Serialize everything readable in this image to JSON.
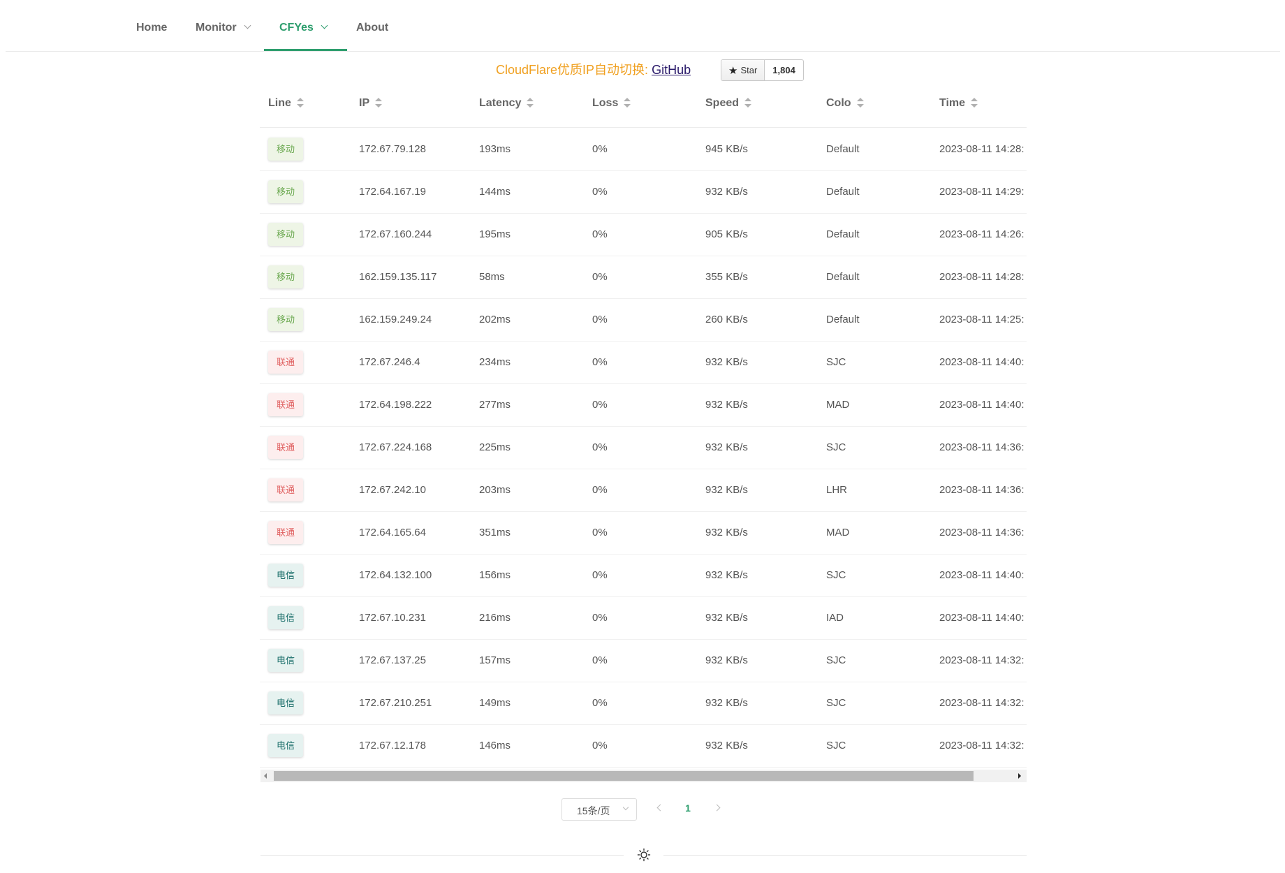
{
  "nav": {
    "items": [
      {
        "label": "Home",
        "dropdown": false
      },
      {
        "label": "Monitor",
        "dropdown": true
      },
      {
        "label": "CFYes",
        "dropdown": true,
        "active": true
      },
      {
        "label": "About",
        "dropdown": false
      }
    ]
  },
  "banner": {
    "text": "CloudFlare优质IP自动切换: ",
    "link": "GitHub"
  },
  "github_star": {
    "label": "Star",
    "count": "1,804"
  },
  "table": {
    "columns": [
      "Line",
      "IP",
      "Latency",
      "Loss",
      "Speed",
      "Colo",
      "Time"
    ],
    "rows": [
      {
        "line": "移动",
        "line_type": "mobile",
        "ip": "172.67.79.128",
        "latency": "193ms",
        "loss": "0%",
        "speed": "945 KB/s",
        "colo": "Default",
        "time": "2023-08-11 14:28:"
      },
      {
        "line": "移动",
        "line_type": "mobile",
        "ip": "172.64.167.19",
        "latency": "144ms",
        "loss": "0%",
        "speed": "932 KB/s",
        "colo": "Default",
        "time": "2023-08-11 14:29:"
      },
      {
        "line": "移动",
        "line_type": "mobile",
        "ip": "172.67.160.244",
        "latency": "195ms",
        "loss": "0%",
        "speed": "905 KB/s",
        "colo": "Default",
        "time": "2023-08-11 14:26:"
      },
      {
        "line": "移动",
        "line_type": "mobile",
        "ip": "162.159.135.117",
        "latency": "58ms",
        "loss": "0%",
        "speed": "355 KB/s",
        "colo": "Default",
        "time": "2023-08-11 14:28:"
      },
      {
        "line": "移动",
        "line_type": "mobile",
        "ip": "162.159.249.24",
        "latency": "202ms",
        "loss": "0%",
        "speed": "260 KB/s",
        "colo": "Default",
        "time": "2023-08-11 14:25:"
      },
      {
        "line": "联通",
        "line_type": "unicom",
        "ip": "172.67.246.4",
        "latency": "234ms",
        "loss": "0%",
        "speed": "932 KB/s",
        "colo": "SJC",
        "time": "2023-08-11 14:40:"
      },
      {
        "line": "联通",
        "line_type": "unicom",
        "ip": "172.64.198.222",
        "latency": "277ms",
        "loss": "0%",
        "speed": "932 KB/s",
        "colo": "MAD",
        "time": "2023-08-11 14:40:"
      },
      {
        "line": "联通",
        "line_type": "unicom",
        "ip": "172.67.224.168",
        "latency": "225ms",
        "loss": "0%",
        "speed": "932 KB/s",
        "colo": "SJC",
        "time": "2023-08-11 14:36:"
      },
      {
        "line": "联通",
        "line_type": "unicom",
        "ip": "172.67.242.10",
        "latency": "203ms",
        "loss": "0%",
        "speed": "932 KB/s",
        "colo": "LHR",
        "time": "2023-08-11 14:36:"
      },
      {
        "line": "联通",
        "line_type": "unicom",
        "ip": "172.64.165.64",
        "latency": "351ms",
        "loss": "0%",
        "speed": "932 KB/s",
        "colo": "MAD",
        "time": "2023-08-11 14:36:"
      },
      {
        "line": "电信",
        "line_type": "telecom",
        "ip": "172.64.132.100",
        "latency": "156ms",
        "loss": "0%",
        "speed": "932 KB/s",
        "colo": "SJC",
        "time": "2023-08-11 14:40:"
      },
      {
        "line": "电信",
        "line_type": "telecom",
        "ip": "172.67.10.231",
        "latency": "216ms",
        "loss": "0%",
        "speed": "932 KB/s",
        "colo": "IAD",
        "time": "2023-08-11 14:40:"
      },
      {
        "line": "电信",
        "line_type": "telecom",
        "ip": "172.67.137.25",
        "latency": "157ms",
        "loss": "0%",
        "speed": "932 KB/s",
        "colo": "SJC",
        "time": "2023-08-11 14:32:"
      },
      {
        "line": "电信",
        "line_type": "telecom",
        "ip": "172.67.210.251",
        "latency": "149ms",
        "loss": "0%",
        "speed": "932 KB/s",
        "colo": "SJC",
        "time": "2023-08-11 14:32:"
      },
      {
        "line": "电信",
        "line_type": "telecom",
        "ip": "172.67.12.178",
        "latency": "146ms",
        "loss": "0%",
        "speed": "932 KB/s",
        "colo": "SJC",
        "time": "2023-08-11 14:32:"
      }
    ]
  },
  "pagination": {
    "page_size": "15条/页",
    "current_page": "1"
  },
  "footer": {
    "theme_toggle_icon": "sun-icon"
  },
  "colors": {
    "accent": "#2e9e6e",
    "banner": "#f0a020",
    "mobile_tag": "#6aa84f",
    "unicom_tag": "#e06060",
    "telecom_tag": "#1a6e6a"
  }
}
